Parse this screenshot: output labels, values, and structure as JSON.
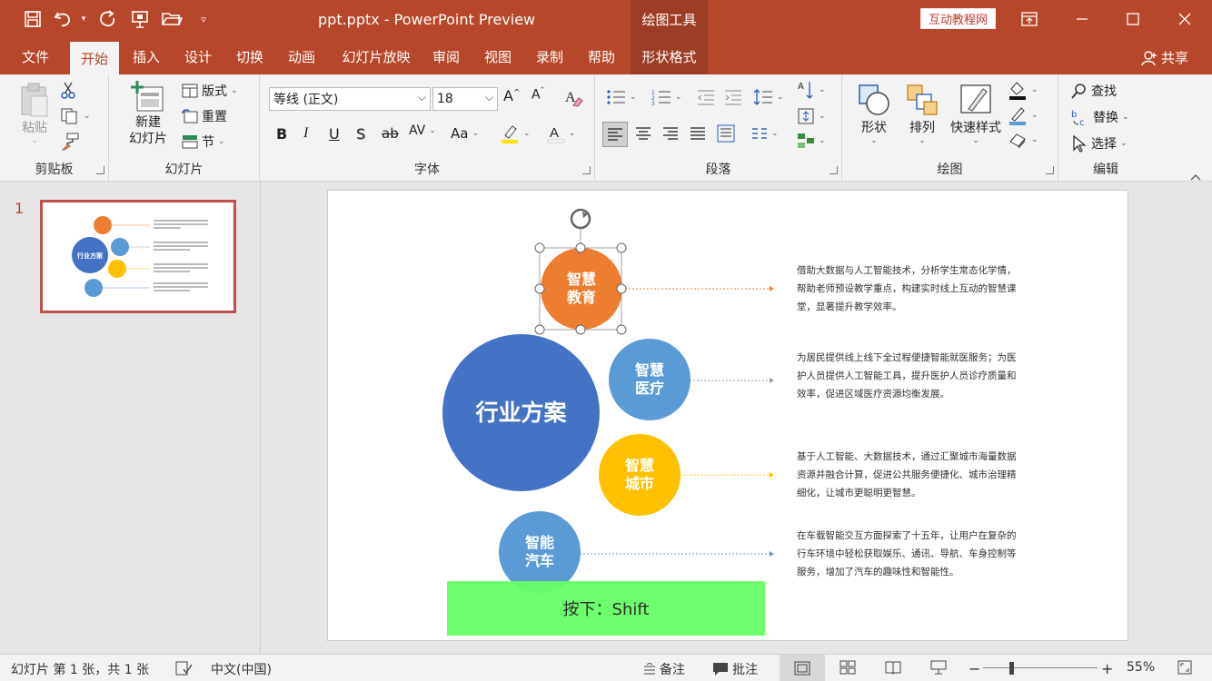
{
  "titlebar": {
    "title": "ppt.pptx  -  PowerPoint Preview",
    "tool_tab": "绘图工具",
    "promo": "互动教程网"
  },
  "menu": {
    "tabs": [
      "文件",
      "开始",
      "插入",
      "设计",
      "切换",
      "动画",
      "幻灯片放映",
      "审阅",
      "视图",
      "录制",
      "帮助",
      "形状格式"
    ],
    "share": "共享"
  },
  "ribbon": {
    "clipboard": {
      "label": "剪贴板",
      "paste": "粘贴"
    },
    "slides": {
      "label": "幻灯片",
      "new_slide": "新建\n幻灯片",
      "layout": "版式",
      "reset": "重置",
      "section": "节"
    },
    "font": {
      "label": "字体",
      "font_name": "等线 (正文)",
      "font_size": "18"
    },
    "paragraph": {
      "label": "段落"
    },
    "drawing": {
      "label": "绘图",
      "shape": "形状",
      "arrange": "排列",
      "quick_styles": "快速样式"
    },
    "editing": {
      "label": "编辑",
      "find": "查找",
      "replace": "替换",
      "select": "选择"
    }
  },
  "thumbnails": {
    "slide_number": "1"
  },
  "slide": {
    "main_circle": "行业方案",
    "items": [
      {
        "label": "智慧\n教育",
        "color": "#ed7d31",
        "desc": "借助大数据与人工智能技术，分析学生常态化学情，帮助老师预设教学重点，构建实时线上互动的智慧课堂，显著提升教学效率。"
      },
      {
        "label": "智慧\n医疗",
        "color": "#5b9bd5",
        "desc": "为居民提供线上线下全过程便捷智能就医服务；为医护人员提供人工智能工具，提升医护人员诊疗质量和效率，促进区域医疗资源均衡发展。"
      },
      {
        "label": "智慧\n城市",
        "color": "#ffc000",
        "desc": "基于人工智能、大数据技术，通过汇聚城市海量数据资源并融合计算，促进公共服务便捷化、城市治理精细化，让城市更聪明更智慧。"
      },
      {
        "label": "智能\n汽车",
        "color": "#5b9bd5",
        "desc": "在车载智能交互方面探索了十五年，让用户在复杂的行车环境中轻松获取娱乐、通讯、导航、车身控制等服务，增加了汽车的趣味性和智能性。"
      }
    ],
    "main_color": "#4472c4",
    "overlay": "按下：Shift"
  },
  "status": {
    "slide_info": "幻灯片 第 1 张，共 1 张",
    "language": "中文(中国)",
    "notes": "备注",
    "comments": "批注",
    "zoom": "55%"
  }
}
